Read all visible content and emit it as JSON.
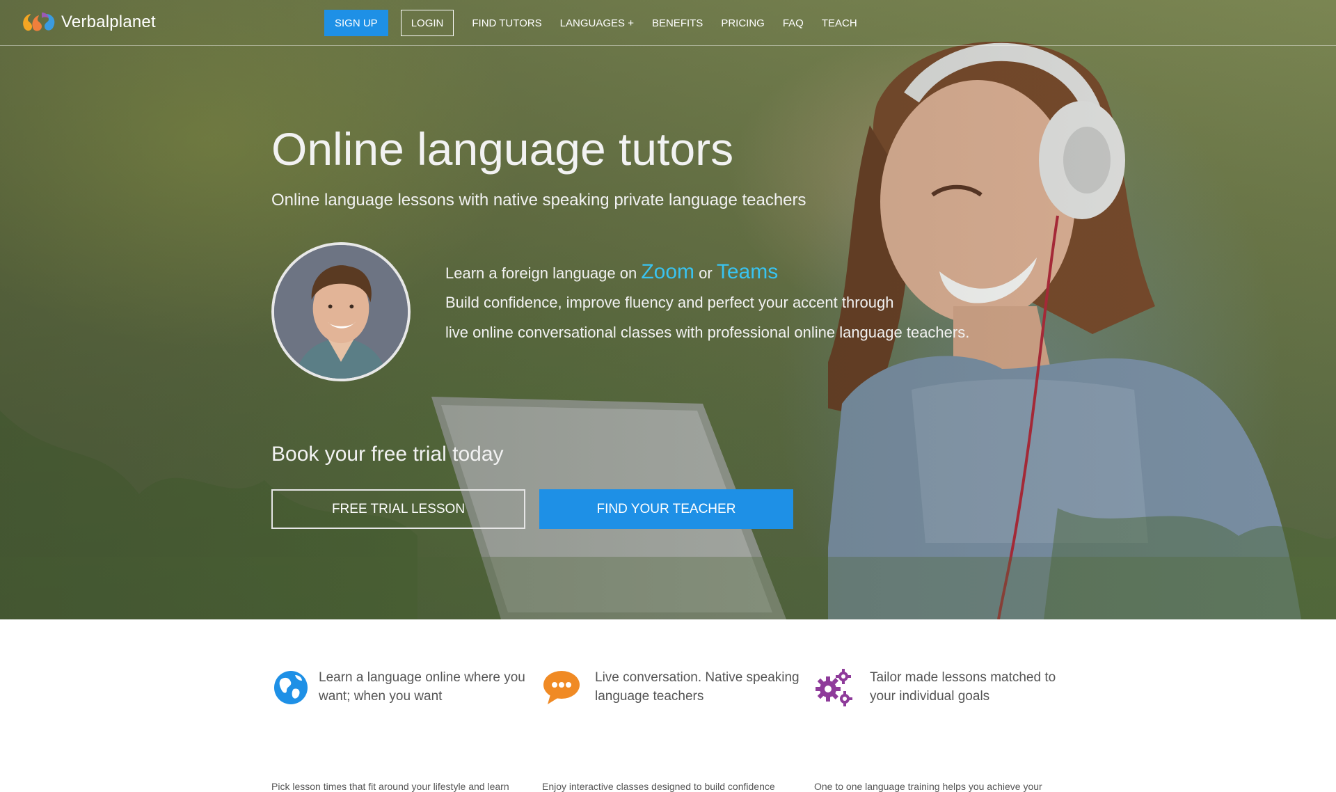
{
  "brand": {
    "name": "Verbalplanet"
  },
  "nav": {
    "signup": "SIGN UP",
    "login": "LOGIN",
    "items": [
      "FIND TUTORS",
      "LANGUAGES +",
      "BENEFITS",
      "PRICING",
      "FAQ",
      "TEACH"
    ]
  },
  "hero": {
    "title": "Online language tutors",
    "subtitle": "Online language lessons with native speaking private language teachers",
    "pitch": {
      "prefix": "Learn a foreign language on",
      "zoom": "Zoom",
      "or": "or",
      "teams": "Teams",
      "line2": "Build confidence, improve fluency and perfect your accent through",
      "line3": "live online conversational classes with professional online language teachers."
    },
    "book": "Book your free trial today",
    "btn_trial": "FREE TRIAL LESSON",
    "btn_find": "FIND YOUR TEACHER"
  },
  "features": [
    {
      "icon": "globe-icon",
      "title": "Learn a language online where you want; when you want",
      "body": "Pick lesson times that fit around your lifestyle and learn"
    },
    {
      "icon": "chat-bubble-icon",
      "title": "Live conversation. Native speaking language teachers",
      "body": "Enjoy interactive classes designed to build confidence"
    },
    {
      "icon": "gears-icon",
      "title": "Tailor made lessons matched to your individual goals",
      "body": "One to one language training helps you achieve your"
    }
  ],
  "colors": {
    "accent": "#1e90e6",
    "highlight": "#39c3f0",
    "chat": "#f08a24",
    "gears": "#8e3b9a",
    "globe": "#1e90e6"
  }
}
